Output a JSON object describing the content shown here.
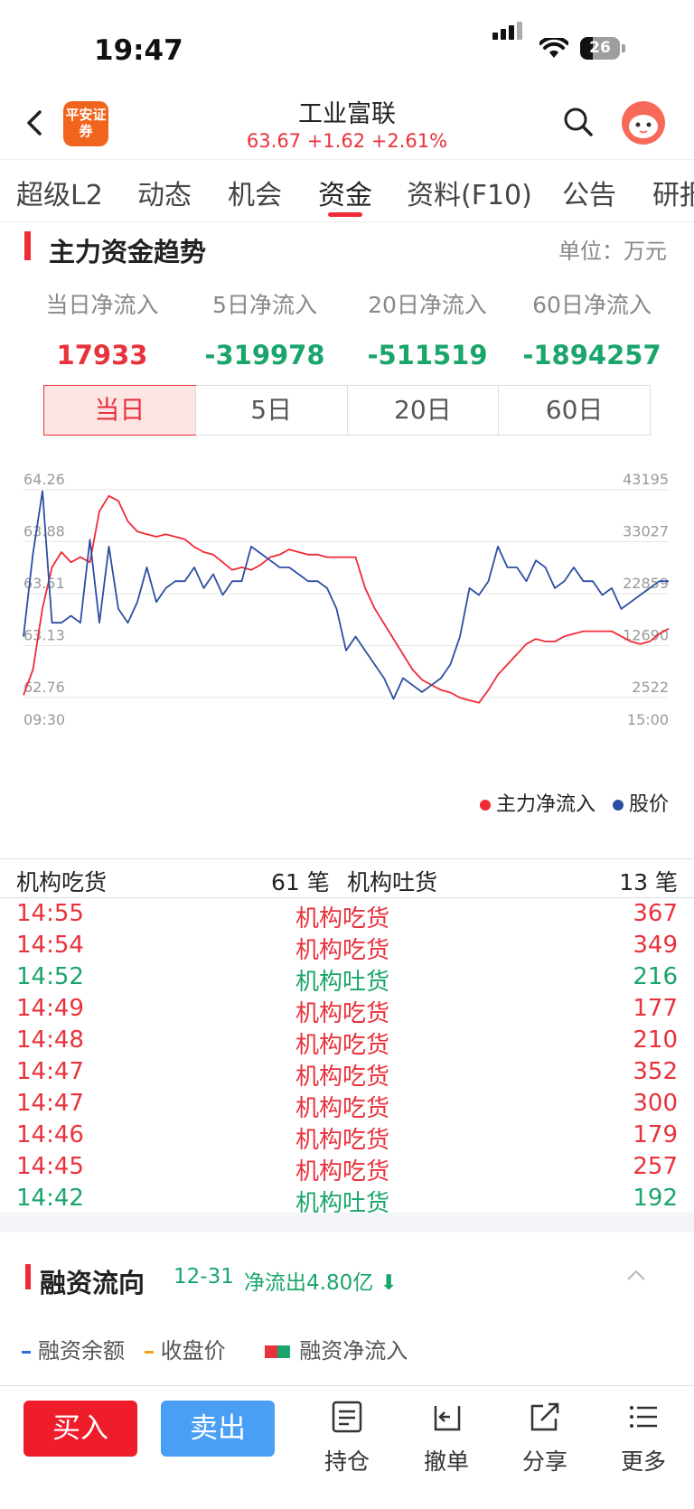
{
  "status": {
    "time": "19:47",
    "battery": "26"
  },
  "header": {
    "logo_text": "平安证券",
    "stock_name": "工业富联",
    "quote": "63.67 +1.62 +2.61%"
  },
  "tabs": [
    "超级L2",
    "动态",
    "机会",
    "资金",
    "资料(F10)",
    "公告",
    "研报"
  ],
  "active_tab": "资金",
  "main_flow": {
    "title": "主力资金趋势",
    "unit": "单位：万元",
    "stats": [
      {
        "label": "当日净流入",
        "value": "17933",
        "dir": "up"
      },
      {
        "label": "5日净流入",
        "value": "-319978",
        "dir": "down"
      },
      {
        "label": "20日净流入",
        "value": "-511519",
        "dir": "down"
      },
      {
        "label": "60日净流入",
        "value": "-1894257",
        "dir": "down"
      }
    ],
    "periods": [
      "当日",
      "5日",
      "20日",
      "60日"
    ],
    "selected_period": "当日"
  },
  "chart_data": {
    "type": "line",
    "left_ticks": [
      "64.26",
      "63.88",
      "63.51",
      "63.13",
      "62.76"
    ],
    "right_ticks": [
      "43195",
      "33027",
      "22859",
      "12690",
      "2522"
    ],
    "x_ticks": [
      "09:30",
      "15:00"
    ],
    "left_range": [
      62.76,
      64.26
    ],
    "right_range": [
      2522,
      43195
    ],
    "grid": true,
    "legend_position": "bottom-right",
    "series": [
      {
        "name": "主力净流入",
        "axis": "right",
        "color": "#ef2b37",
        "values": [
          3000,
          8000,
          20000,
          28000,
          31000,
          29000,
          30000,
          29000,
          39000,
          42000,
          41000,
          37000,
          35000,
          34500,
          34000,
          34500,
          34000,
          33500,
          32000,
          31000,
          30500,
          29000,
          27500,
          28000,
          27500,
          28500,
          30000,
          30500,
          31500,
          31000,
          30500,
          30500,
          30000,
          30000,
          30000,
          30000,
          24000,
          20000,
          17000,
          14000,
          11000,
          8000,
          6000,
          5000,
          4000,
          3500,
          2500,
          2000,
          1500,
          4000,
          7000,
          9000,
          11000,
          13000,
          14000,
          13500,
          13500,
          14500,
          15000,
          15500,
          15500,
          15500,
          15500,
          14500,
          13500,
          13000,
          13500,
          15000,
          16000
        ]
      },
      {
        "name": "股价",
        "axis": "left",
        "color": "#2c4ea2",
        "values": [
          63.2,
          63.8,
          64.25,
          63.3,
          63.3,
          63.35,
          63.3,
          63.9,
          63.3,
          63.85,
          63.4,
          63.3,
          63.45,
          63.7,
          63.45,
          63.55,
          63.6,
          63.6,
          63.7,
          63.55,
          63.65,
          63.5,
          63.6,
          63.6,
          63.85,
          63.8,
          63.75,
          63.7,
          63.7,
          63.65,
          63.6,
          63.6,
          63.55,
          63.4,
          63.1,
          63.2,
          63.1,
          63.0,
          62.9,
          62.75,
          62.9,
          62.85,
          62.8,
          62.85,
          62.9,
          63.0,
          63.2,
          63.55,
          63.5,
          63.6,
          63.85,
          63.7,
          63.7,
          63.6,
          63.75,
          63.7,
          63.55,
          63.6,
          63.7,
          63.6,
          63.6,
          63.5,
          63.55,
          63.4,
          63.45,
          63.5,
          63.55,
          63.6,
          63.6
        ]
      }
    ]
  },
  "institutions": {
    "buy_label": "机构吃货",
    "buy_count": "61 笔",
    "sell_label": "机构吐货",
    "sell_count": "13 笔",
    "rows": [
      {
        "time": "14:55",
        "type": "机构吃货",
        "vol": "367",
        "side": "buy"
      },
      {
        "time": "14:54",
        "type": "机构吃货",
        "vol": "349",
        "side": "buy"
      },
      {
        "time": "14:52",
        "type": "机构吐货",
        "vol": "216",
        "side": "sell"
      },
      {
        "time": "14:49",
        "type": "机构吃货",
        "vol": "177",
        "side": "buy"
      },
      {
        "time": "14:48",
        "type": "机构吃货",
        "vol": "210",
        "side": "buy"
      },
      {
        "time": "14:47",
        "type": "机构吃货",
        "vol": "352",
        "side": "buy"
      },
      {
        "time": "14:47",
        "type": "机构吃货",
        "vol": "300",
        "side": "buy"
      },
      {
        "time": "14:46",
        "type": "机构吃货",
        "vol": "179",
        "side": "buy"
      },
      {
        "time": "14:45",
        "type": "机构吃货",
        "vol": "257",
        "side": "buy"
      },
      {
        "time": "14:42",
        "type": "机构吐货",
        "vol": "192",
        "side": "sell"
      }
    ]
  },
  "margin": {
    "title": "融资流向",
    "date": "12-31",
    "net": "净流出4.80亿",
    "legend": [
      "融资余额",
      "收盘价",
      "融资净流入"
    ]
  },
  "bottom_bar": {
    "buy": "买入",
    "sell": "卖出",
    "tools": [
      "持仓",
      "撤单",
      "分享",
      "更多"
    ]
  },
  "colors": {
    "up": "#e8323c",
    "down": "#1aa56b",
    "accent": "#ef2b37",
    "price_line": "#2c4ea2"
  }
}
